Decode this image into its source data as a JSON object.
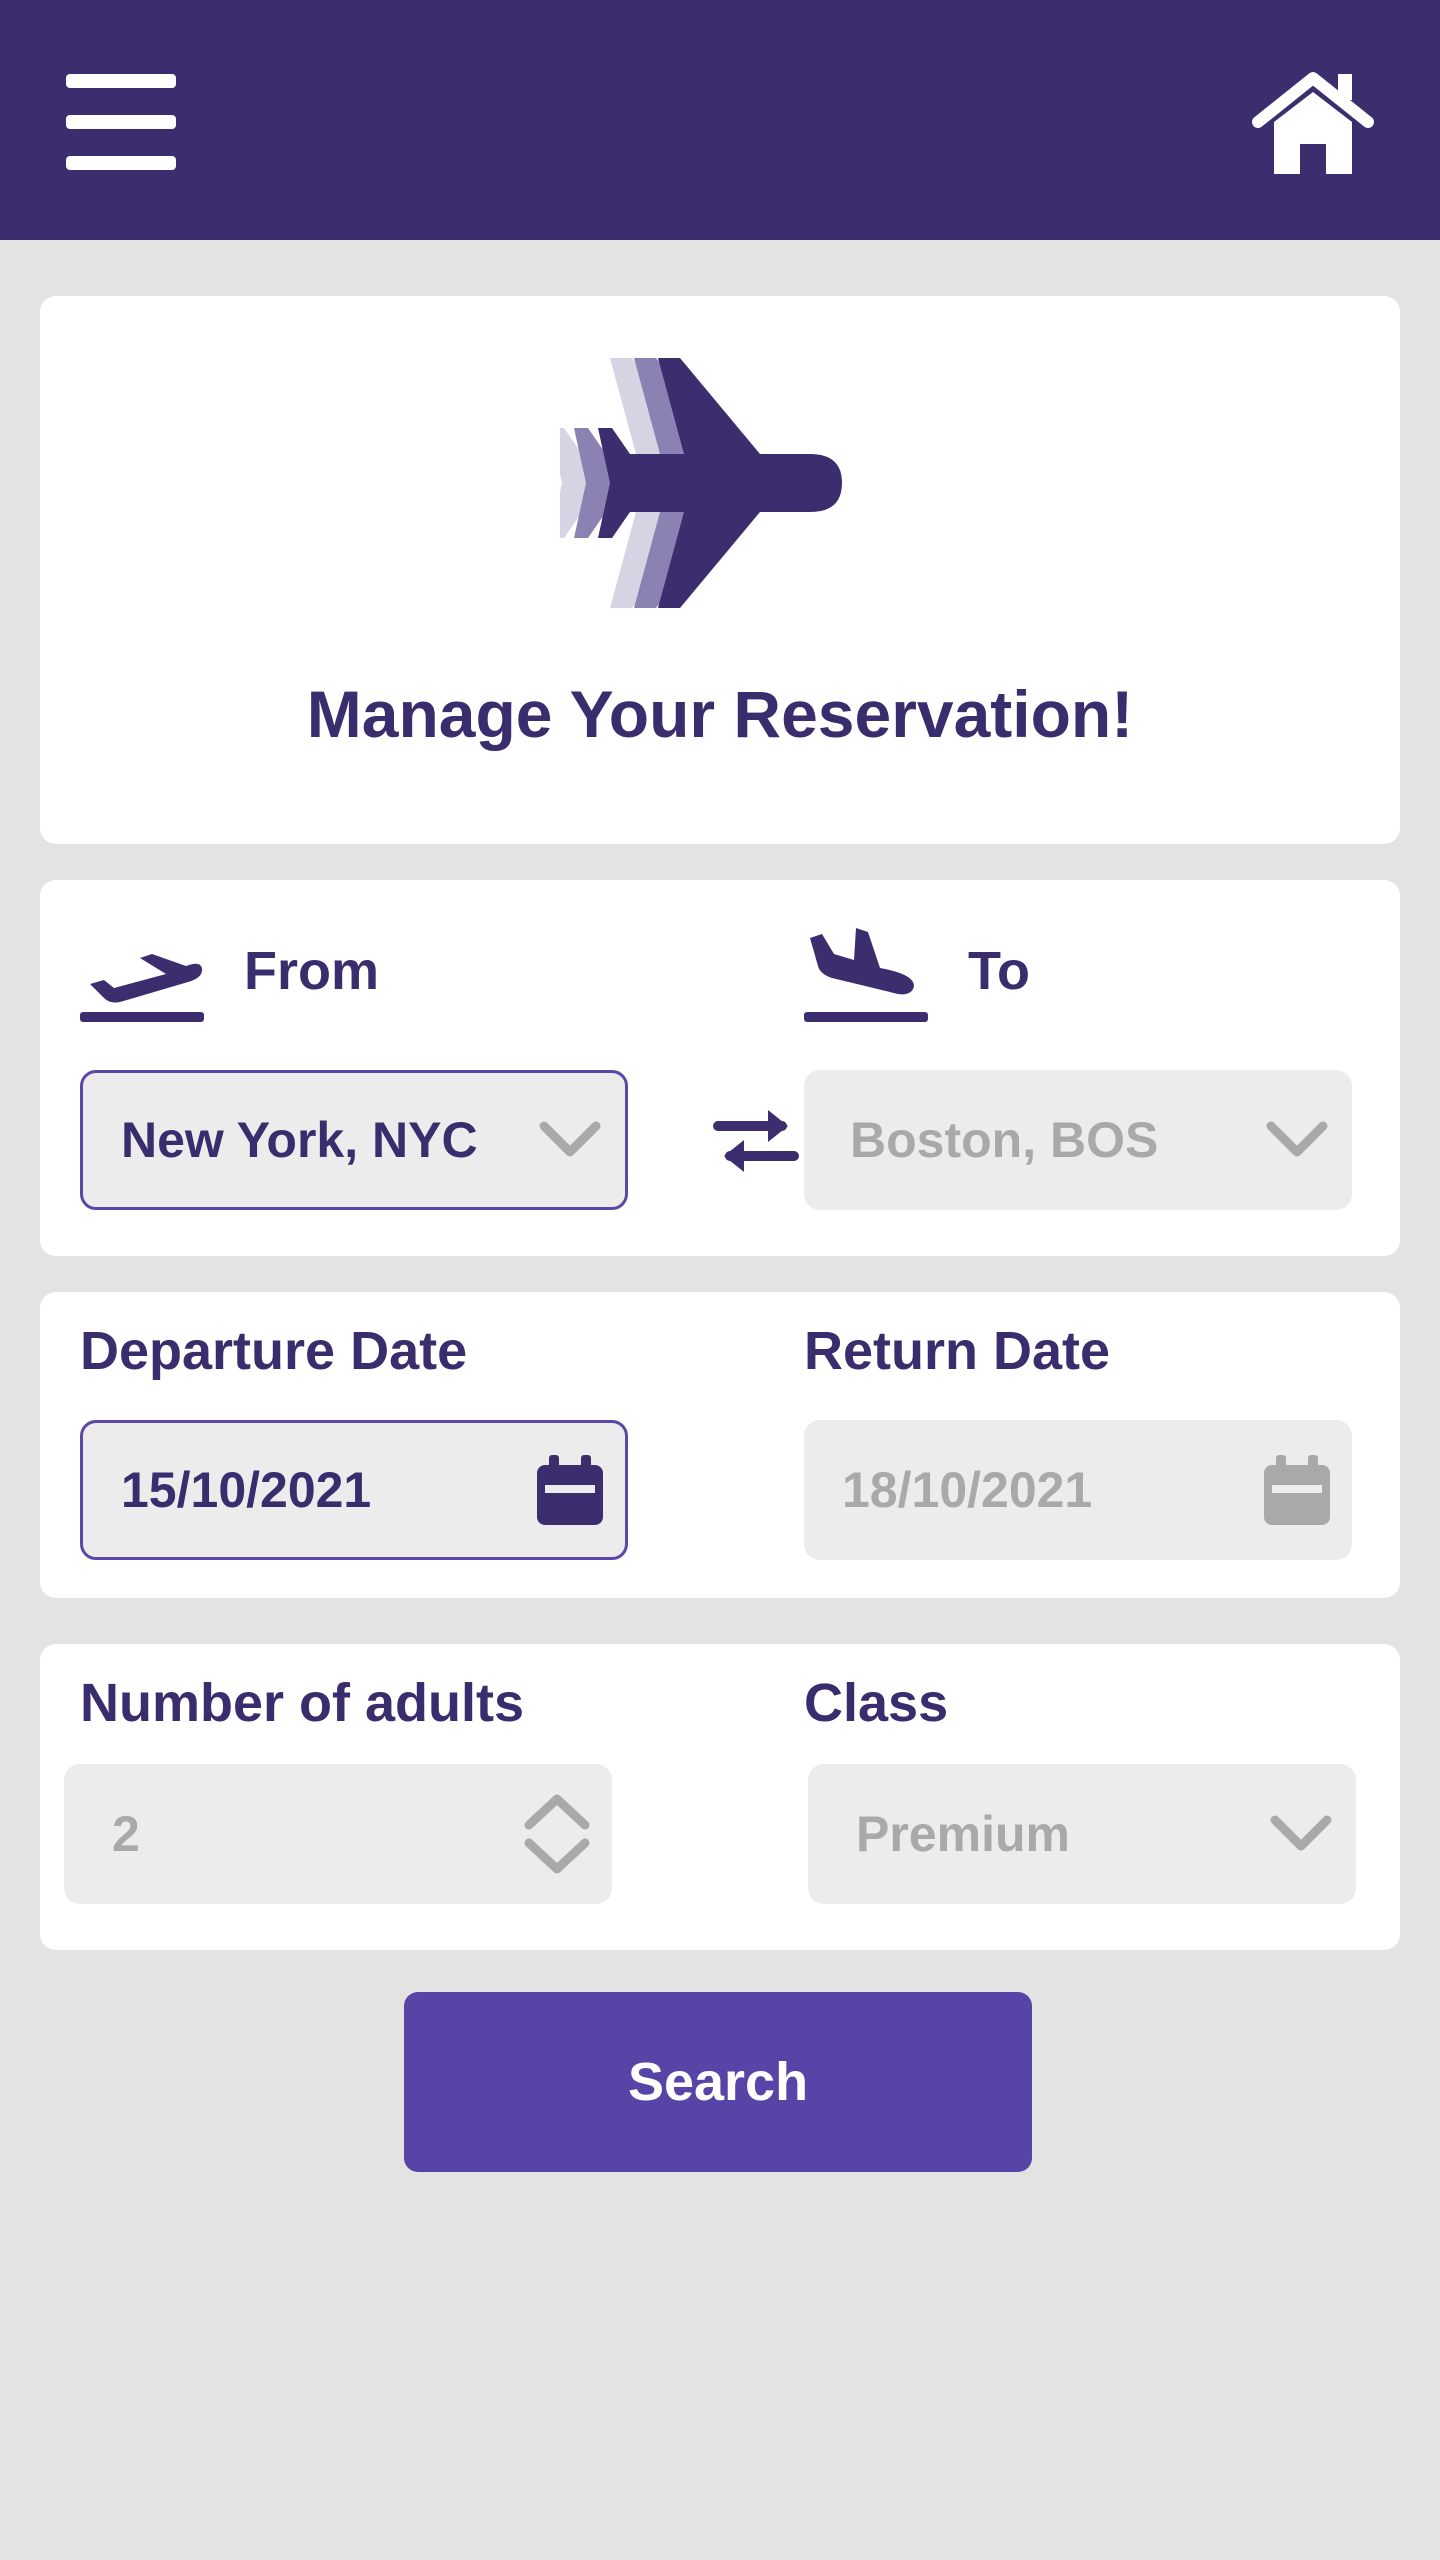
{
  "header": {
    "menu_icon": "hamburger-menu-icon",
    "home_icon": "home-icon"
  },
  "hero": {
    "icon": "airplane-icon",
    "title": "Manage Your Reservation!"
  },
  "route": {
    "from_label": "From",
    "from_icon": "plane-departure-icon",
    "from_value": "New York, NYC",
    "to_label": "To",
    "to_icon": "plane-arrival-icon",
    "to_value": "Boston, BOS",
    "swap_icon": "swap-arrows-icon"
  },
  "dates": {
    "departure_label": "Departure Date",
    "departure_value": "15/10/2021",
    "return_label": "Return Date",
    "return_value": "18/10/2021"
  },
  "passengers": {
    "adults_label": "Number of adults",
    "adults_value": "2",
    "class_label": "Class",
    "class_value": "Premium"
  },
  "actions": {
    "search_label": "Search"
  },
  "colors": {
    "header_bg": "#3c2d6f",
    "accent": "#5843a7",
    "text_primary": "#3a2d6e",
    "text_disabled": "#a9a9a9",
    "field_bg": "#ececec",
    "page_bg": "#e3e3e3"
  }
}
